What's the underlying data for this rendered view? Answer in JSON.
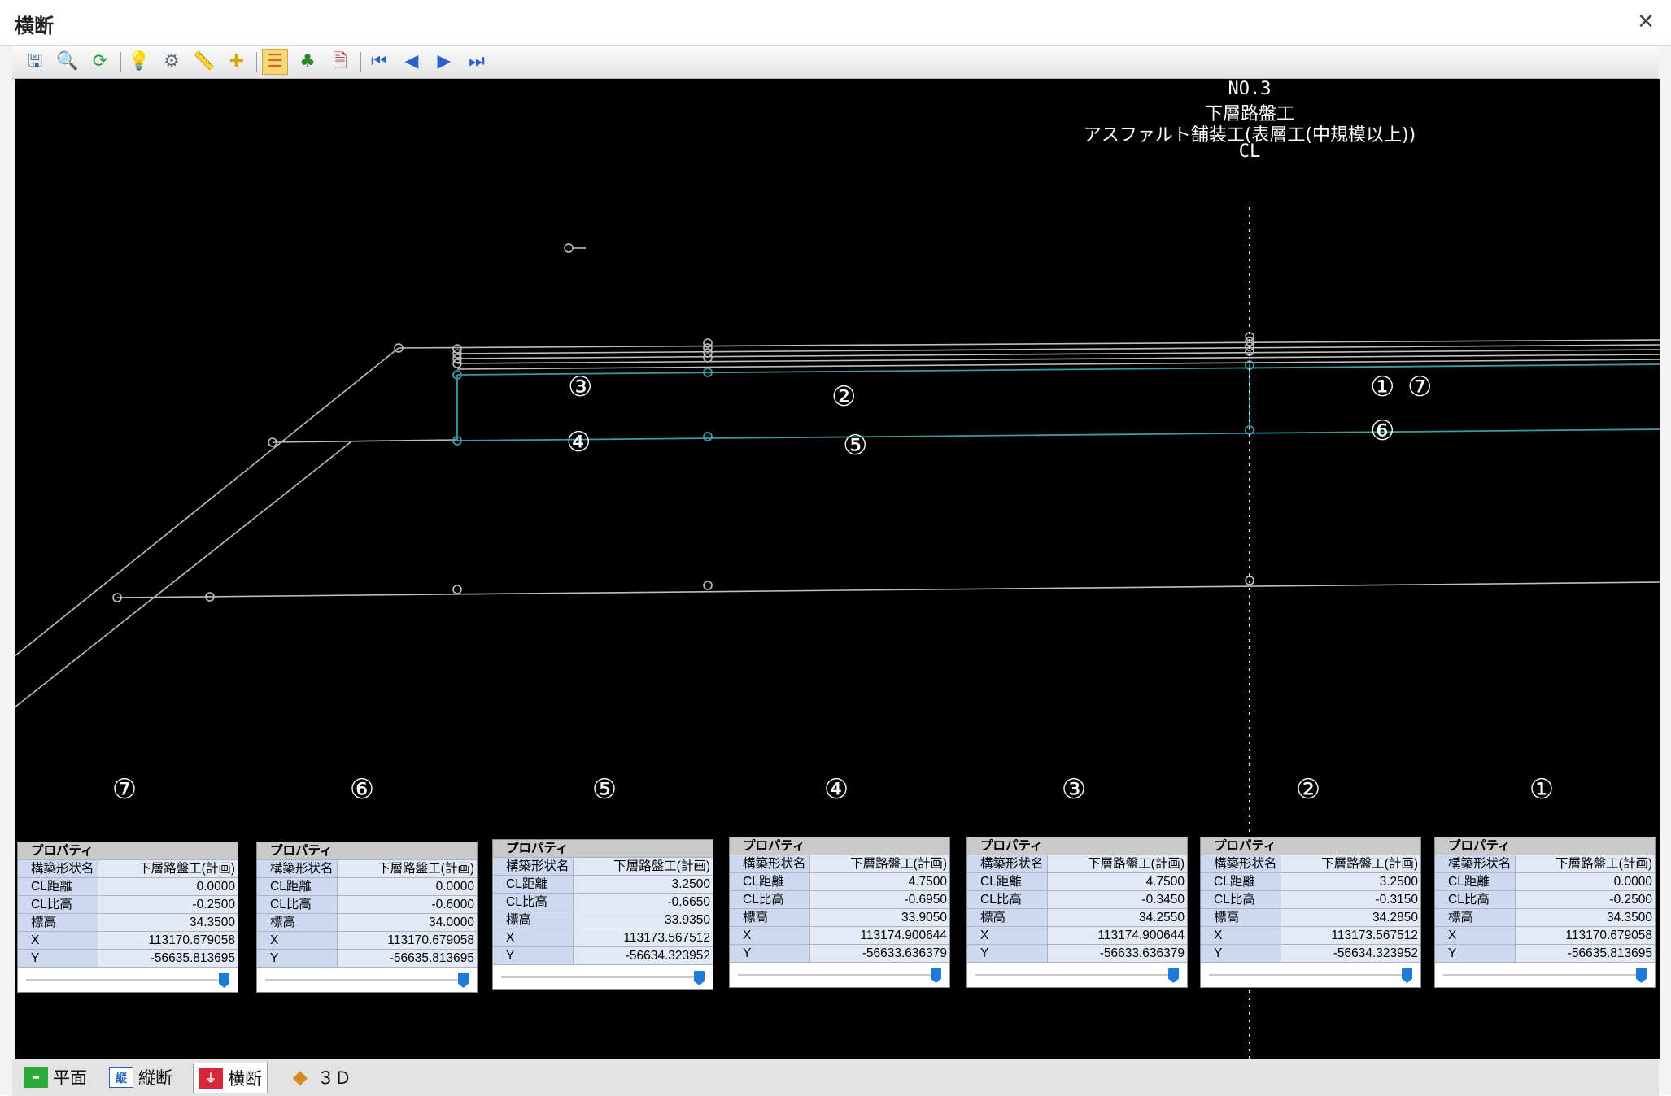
{
  "window": {
    "title": "横断",
    "close_icon": "close-icon"
  },
  "toolbar": {
    "items": [
      {
        "name": "save-view",
        "icon": "floppy-icon"
      },
      {
        "name": "zoom",
        "icon": "magnifier-icon"
      },
      {
        "name": "refresh",
        "icon": "refresh-icon"
      },
      {
        "name": "hint",
        "icon": "lightbulb-icon"
      },
      {
        "name": "settings",
        "icon": "settings-icon"
      },
      {
        "name": "measure",
        "icon": "ruler-icon"
      },
      {
        "name": "points",
        "icon": "points-icon"
      },
      {
        "name": "layers",
        "icon": "layers-icon",
        "active": true
      },
      {
        "name": "trees",
        "icon": "trees-icon"
      },
      {
        "name": "document",
        "icon": "document-icon"
      },
      {
        "name": "first",
        "icon": "first-icon"
      },
      {
        "name": "prev",
        "icon": "prev-icon"
      },
      {
        "name": "next",
        "icon": "next-icon"
      },
      {
        "name": "last",
        "icon": "last-icon"
      }
    ]
  },
  "section": {
    "station": "NO.3",
    "layer": "下層路盤工",
    "pavement": "アスファルト舗装工(表層工(中規模以上))",
    "centerline": "CL"
  },
  "canvas_markers": [
    "③",
    "②",
    "①",
    "⑦",
    "④",
    "⑤",
    "⑥"
  ],
  "panel_markers": [
    "⑦",
    "⑥",
    "⑤",
    "④",
    "③",
    "②",
    "①"
  ],
  "property_panels": [
    {
      "marker": "⑦",
      "header": "プロパティ",
      "rows": [
        [
          "構築形状名",
          "下層路盤工(計画)"
        ],
        [
          "CL距離",
          "0.0000"
        ],
        [
          "CL比高",
          "-0.2500"
        ],
        [
          "標高",
          "34.3500"
        ],
        [
          "X",
          "113170.679058"
        ],
        [
          "Y",
          "-56635.813695"
        ]
      ]
    },
    {
      "marker": "⑥",
      "header": "プロパティ",
      "rows": [
        [
          "構築形状名",
          "下層路盤工(計画)"
        ],
        [
          "CL距離",
          "0.0000"
        ],
        [
          "CL比高",
          "-0.6000"
        ],
        [
          "標高",
          "34.0000"
        ],
        [
          "X",
          "113170.679058"
        ],
        [
          "Y",
          "-56635.813695"
        ]
      ]
    },
    {
      "marker": "⑤",
      "header": "プロパティ",
      "rows": [
        [
          "構築形状名",
          "下層路盤工(計画)"
        ],
        [
          "CL距離",
          "3.2500"
        ],
        [
          "CL比高",
          "-0.6650"
        ],
        [
          "標高",
          "33.9350"
        ],
        [
          "X",
          "113173.567512"
        ],
        [
          "Y",
          "-56634.323952"
        ]
      ]
    },
    {
      "marker": "④",
      "header": "プロパティ",
      "rows": [
        [
          "構築形状名",
          "下層路盤工(計画)"
        ],
        [
          "CL距離",
          "4.7500"
        ],
        [
          "CL比高",
          "-0.6950"
        ],
        [
          "標高",
          "33.9050"
        ],
        [
          "X",
          "113174.900644"
        ],
        [
          "Y",
          "-56633.636379"
        ]
      ]
    },
    {
      "marker": "③",
      "header": "プロパティ",
      "rows": [
        [
          "構築形状名",
          "下層路盤工(計画)"
        ],
        [
          "CL距離",
          "4.7500"
        ],
        [
          "CL比高",
          "-0.3450"
        ],
        [
          "標高",
          "34.2550"
        ],
        [
          "X",
          "113174.900644"
        ],
        [
          "Y",
          "-56633.636379"
        ]
      ]
    },
    {
      "marker": "②",
      "header": "プロパティ",
      "rows": [
        [
          "構築形状名",
          "下層路盤工(計画)"
        ],
        [
          "CL距離",
          "3.2500"
        ],
        [
          "CL比高",
          "-0.3150"
        ],
        [
          "標高",
          "34.2850"
        ],
        [
          "X",
          "113173.567512"
        ],
        [
          "Y",
          "-56634.323952"
        ]
      ]
    },
    {
      "marker": "①",
      "header": "プロパティ",
      "rows": [
        [
          "構築形状名",
          "下層路盤工(計画)"
        ],
        [
          "CL距離",
          "0.0000"
        ],
        [
          "CL比高",
          "-0.2500"
        ],
        [
          "標高",
          "34.3500"
        ],
        [
          "X",
          "113170.679058"
        ],
        [
          "Y",
          "-56635.813695"
        ]
      ]
    }
  ],
  "tabs": [
    {
      "label": "平面",
      "icon": "plan-icon",
      "active": false
    },
    {
      "label": "縦断",
      "icon": "profile-icon",
      "active": false
    },
    {
      "label": "横断",
      "icon": "cross-section-icon",
      "active": true
    },
    {
      "label": "３Ｄ",
      "icon": "cube-icon",
      "active": false
    }
  ],
  "colors": {
    "canvas_bg": "#000000",
    "line": "#bfbfbf",
    "cyan": "#3a9aa0",
    "accent": "#1f7ad8"
  }
}
